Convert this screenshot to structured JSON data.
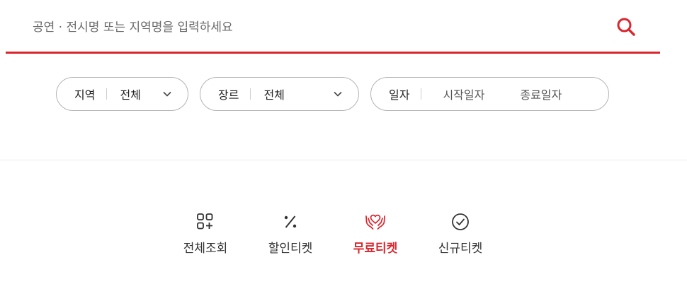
{
  "search": {
    "placeholder": "공연 · 전시명 또는 지역명을 입력하세요",
    "value": "",
    "icon": "search-icon"
  },
  "filters": {
    "region": {
      "label": "지역",
      "value": "전체"
    },
    "genre": {
      "label": "장르",
      "value": "전체"
    },
    "date": {
      "label": "일자",
      "start": "시작일자",
      "end": "종료일자"
    }
  },
  "categories": [
    {
      "label": "전체조회",
      "icon": "grid-plus-icon",
      "active": false
    },
    {
      "label": "할인티켓",
      "icon": "percent-icon",
      "active": false
    },
    {
      "label": "무료티켓",
      "icon": "heart-hands-icon",
      "active": true
    },
    {
      "label": "신규티켓",
      "icon": "check-circle-icon",
      "active": false
    }
  ],
  "colors": {
    "accent": "#d9262e",
    "border": "#b3b3b3",
    "text": "#222222"
  }
}
